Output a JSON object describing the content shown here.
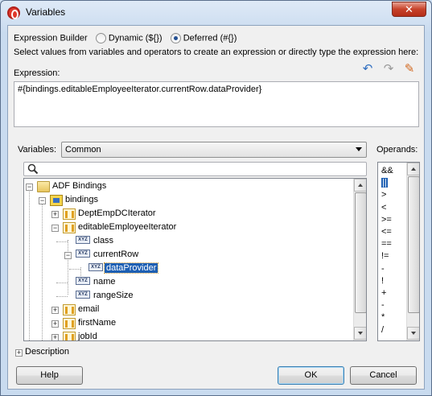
{
  "window": {
    "title": "Variables",
    "close_glyph": "✕"
  },
  "builder": {
    "label": "Expression Builder",
    "option_dynamic": "Dynamic (${})",
    "option_deferred": "Deferred (#{})",
    "selected": "deferred",
    "instructions": "Select values from variables and operators to create an expression or directly type the expression here:"
  },
  "toolbar": {
    "undo_icon": "undo-icon",
    "redo_icon": "redo-icon",
    "clear_icon": "eraser-icon"
  },
  "expression": {
    "label": "Expression:",
    "value": "#{bindings.editableEmployeeIterator.currentRow.dataProvider}"
  },
  "variables": {
    "label": "Variables:",
    "selected": "Common",
    "search_value": ""
  },
  "tree": [
    {
      "label": "ADF Bindings",
      "icon": "folder-icon",
      "expander": "−"
    },
    {
      "label": "bindings",
      "icon": "bindings-icon",
      "expander": "−"
    },
    {
      "label": "DeptEmpDCIterator",
      "icon": "iterator-icon",
      "expander": "+"
    },
    {
      "label": "editableEmployeeIterator",
      "icon": "iterator-icon",
      "expander": "−"
    },
    {
      "label": "class",
      "icon": "xyz-icon",
      "expander": ""
    },
    {
      "label": "currentRow",
      "icon": "xyz-icon",
      "expander": "−"
    },
    {
      "label": "dataProvider",
      "icon": "xyz-icon",
      "expander": "",
      "selected": true
    },
    {
      "label": "name",
      "icon": "xyz-icon",
      "expander": ""
    },
    {
      "label": "rangeSize",
      "icon": "xyz-icon",
      "expander": ""
    },
    {
      "label": "email",
      "icon": "attribute-icon",
      "expander": "+"
    },
    {
      "label": "firstName",
      "icon": "attribute-icon",
      "expander": "+"
    },
    {
      "label": "jobId",
      "icon": "attribute-icon",
      "expander": "+"
    }
  ],
  "xyz_text": "XYZ",
  "operands": {
    "label": "Operands:",
    "items": [
      "&&",
      "||",
      ">",
      "<",
      ">=",
      "<=",
      "==",
      "!=",
      "-",
      "!",
      "+",
      "-",
      "*",
      "/"
    ],
    "selected_index": 1
  },
  "description": {
    "label": "Description",
    "expander": "+"
  },
  "buttons": {
    "help": "Help",
    "ok": "OK",
    "cancel": "Cancel"
  }
}
